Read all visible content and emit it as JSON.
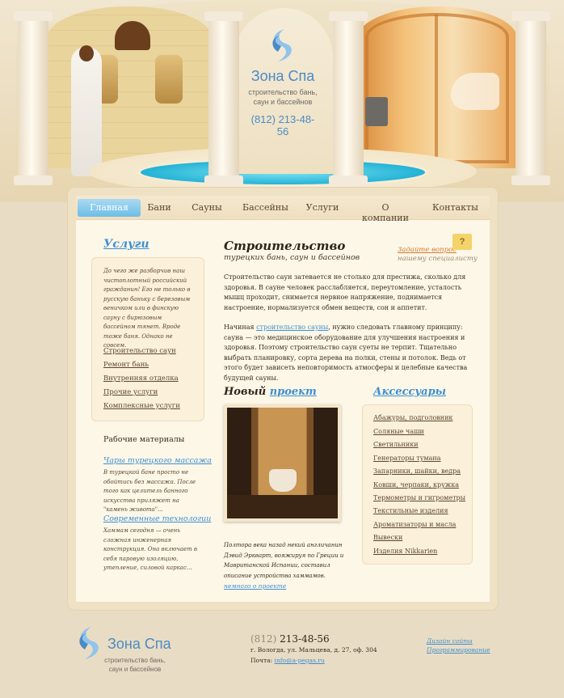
{
  "header": {
    "logo_name": "Зона Спа",
    "logo_tagline": "строительство бань, саун и бассейнов",
    "phone": "(812) 213-48-56"
  },
  "nav": {
    "items": [
      {
        "label": "Главная",
        "active": true
      },
      {
        "label": "Бани"
      },
      {
        "label": "Сауны"
      },
      {
        "label": "Бассейны"
      },
      {
        "label": "Услуги"
      },
      {
        "label": "О компании"
      },
      {
        "label": "Контакты"
      }
    ]
  },
  "services": {
    "heading": "Услуги",
    "intro": "До чего же разборчив наш чистоплотный российский гражданин! Его не только в русскую баньку с березовым веничком или в финскую сауну с бирюзовым бассейном тянет. Вроде тоже баня. Однако не совсем.",
    "links": [
      "Строительство саун",
      "Ремонт бань",
      "Внутренняя отделка",
      "Прочие услуги",
      "Комплексные услуги"
    ]
  },
  "materials": {
    "heading": "Рабочие материалы",
    "articles": [
      {
        "title": "Чары турецкого массажа",
        "text": "В турецкой бане просто не обойтись без массажа. После того как целитель банного искусства приляжет на \"камень живота\"..."
      },
      {
        "title": "Современные технологии",
        "text": "Хаммам сегодня — очень сложная инженерная конструкция. Она включает в себя паровую изоляцию, утепление, силовой каркас..."
      }
    ]
  },
  "main": {
    "title": "Строительство",
    "subtitle": "турецких бань, саун и бассейнов",
    "ask_question": "Задайте вопрос",
    "ask_specialist": "нашему специалисту",
    "ask_icon": "?",
    "paragraph1": "Строительство саун затевается не столько для престижа, сколько для здоровья. В сауне человек расслабляется, переутомление, усталость мышц проходит, снимается нервное напряжение, поднимается настроение, нормализуется обмен веществ, сон и аппетит.",
    "paragraph2_before": "Начиная ",
    "paragraph2_link": "строительство сауны",
    "paragraph2_after": ", нужно следовать главному принципу: сауна — это медицинское оборудование для улучшения настроения и здоровья. Поэтому строительство саун суеты не терпит. Тщательно выбрать планировку, сорта дерева на полки, стены и потолок. Ведь от этого будет зависеть неповторимость атмосферы и целебные качества будущей сауны."
  },
  "project": {
    "heading_plain": "Новый",
    "heading_link": "проект",
    "caption": "Полтора века назад некий англичанин Дэвид Эркварт, вояжируя по Греции и Мавританской Испании, составил описание устройства хаммамов.",
    "more_link": "немного о проекте"
  },
  "accessories": {
    "heading": "Аксессуары",
    "links": [
      "Абажуры, подголовник",
      "Соляные чаши",
      "Светильники",
      "Генераторы тумана",
      "Запарники, шайки, ведра",
      "Ковши, черпаки, кружка",
      "Термометры и гигрометры",
      "Текстильные изделия",
      "Ароматизаторы и масла",
      "Вывески",
      "Изделия Nikkarien"
    ]
  },
  "footer": {
    "logo_name": "Зона Спа",
    "logo_tagline": "строительство бань, саун и бассейнов",
    "phone_code": "(812)",
    "phone_number": "213-48-56",
    "address": "г. Вологда, ул. Мальцева, д. 27, оф. 304",
    "mail_label": "Почта: ",
    "mail": "info@a-pegas.ru",
    "design_link": "Дизайн сайта",
    "programming_link": "Программирование"
  },
  "colors": {
    "accent_blue": "#3d8fd0",
    "nav_active": "#6dbde6",
    "background": "#e9dcc4"
  }
}
